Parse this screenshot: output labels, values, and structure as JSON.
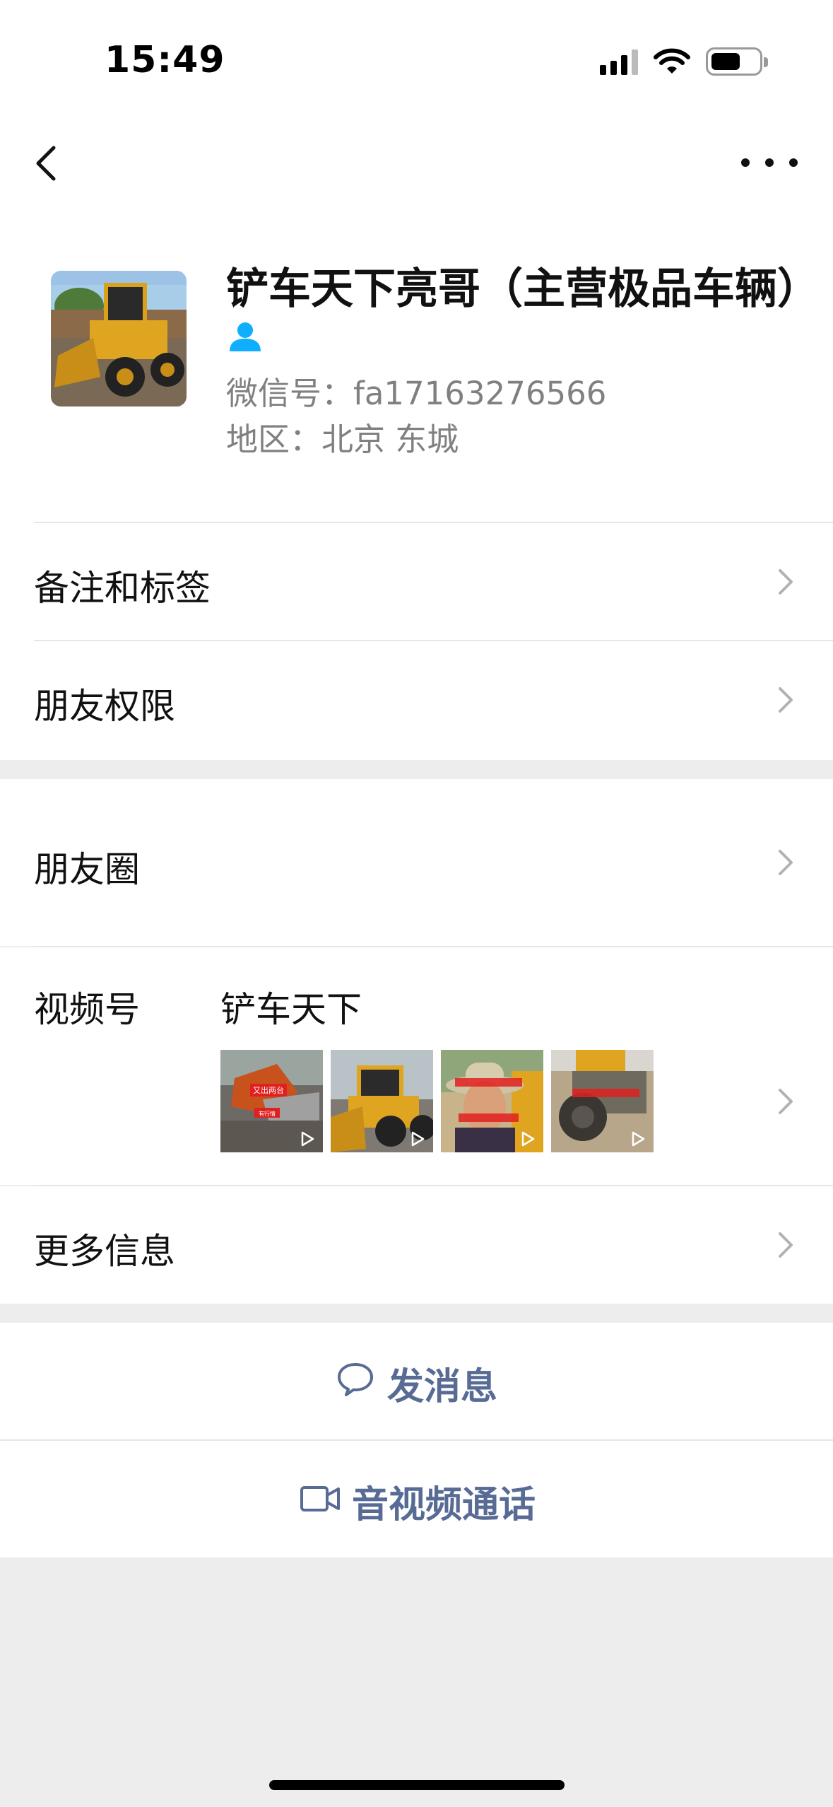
{
  "status_bar": {
    "time": "15:49"
  },
  "profile": {
    "name": "铲车天下亮哥（主营极品车辆）",
    "wechat_id": "微信号：fa17163276566",
    "region": "地区：北京 东城"
  },
  "rows": {
    "remarks_tags": "备注和标签",
    "friend_permissions": "朋友权限",
    "moments": "朋友圈",
    "channels_label": "视频号",
    "channels_name": "铲车天下",
    "more_info": "更多信息"
  },
  "thumbnails": [
    {
      "text_a": "又出两台",
      "text_b": "有行情"
    },
    {
      "text_a": "",
      "text_b": ""
    },
    {
      "text_a": "",
      "text_b": ""
    },
    {
      "text_a": "",
      "text_b": ""
    }
  ],
  "actions": {
    "send_message": "发消息",
    "av_call": "音视频通话"
  },
  "colors": {
    "link": "#576b95",
    "gender_icon": "#10aeff",
    "secondary_text": "#808080",
    "background": "#ededed"
  },
  "icons": {
    "back": "chevron-left-icon",
    "more": "more-dots-icon",
    "gender": "person-icon",
    "chat": "chat-bubble-icon",
    "video": "video-camera-icon"
  }
}
